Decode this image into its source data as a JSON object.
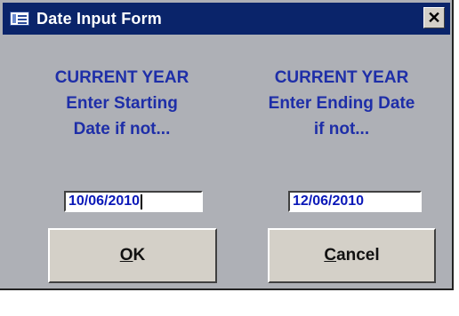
{
  "window": {
    "title": "Date Input Form",
    "close_symbol": "✕",
    "icon": "form-icon",
    "colors": {
      "titlebar": "#0a246a",
      "background": "#aeb0b6",
      "prompt_text": "#1e2ea8",
      "input_text": "#0a18b8"
    }
  },
  "prompts": {
    "start": "CURRENT YEAR\nEnter Starting\nDate if not...",
    "end": "CURRENT YEAR\nEnter Ending Date\nif not..."
  },
  "fields": {
    "start_date": "10/06/2010",
    "end_date": "12/06/2010"
  },
  "buttons": {
    "ok": {
      "access_key": "O",
      "rest": "K"
    },
    "cancel": {
      "access_key": "C",
      "rest": "ancel"
    }
  }
}
